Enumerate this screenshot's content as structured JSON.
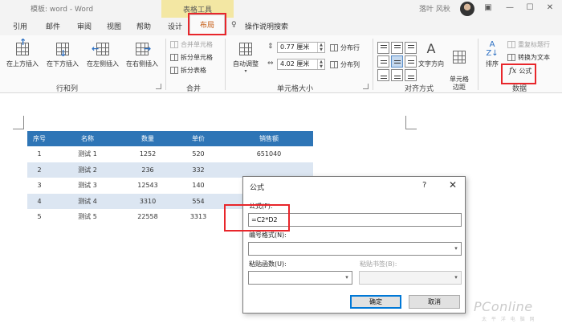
{
  "titlebar": {
    "doc_title": "模板: word - Word",
    "context_label": "表格工具",
    "user_name": "落叶 风秋",
    "min": "—",
    "restore": "☐",
    "close": "✕"
  },
  "tabs": [
    "引用",
    "邮件",
    "审阅",
    "视图",
    "帮助",
    "设计",
    "布局"
  ],
  "active_tab": "布局",
  "tell_me": "操作说明搜索",
  "ribbon": {
    "rows_cols": {
      "insert_above": "在上方插入",
      "insert_below": "在下方插入",
      "insert_left": "在左侧插入",
      "insert_right": "在右侧插入",
      "label": "行和列"
    },
    "merge": {
      "merge_cells": "合并单元格",
      "split_cells": "拆分单元格",
      "split_table": "拆分表格",
      "label": "合并"
    },
    "cell_size": {
      "autofit": "自动调整",
      "height": "0.77 厘米",
      "width": "4.02 厘米",
      "distribute_rows": "分布行",
      "distribute_cols": "分布列",
      "label": "单元格大小"
    },
    "alignment": {
      "text_direction": "文字方向",
      "cell_margins": "单元格\n边距",
      "label": "对齐方式"
    },
    "data": {
      "sort": "排序",
      "repeat_header": "重复标题行",
      "convert_to_text": "转换为文本",
      "formula": "公式",
      "label": "数据"
    }
  },
  "table": {
    "headers": [
      "序号",
      "名称",
      "数量",
      "单价",
      "销售额"
    ],
    "rows": [
      [
        "1",
        "测试 1",
        "1252",
        "520",
        "651040"
      ],
      [
        "2",
        "测试 2",
        "236",
        "332",
        ""
      ],
      [
        "3",
        "测试 3",
        "12543",
        "140",
        ""
      ],
      [
        "4",
        "测试 4",
        "3310",
        "554",
        ""
      ],
      [
        "5",
        "测试 5",
        "22558",
        "3313",
        ""
      ]
    ]
  },
  "dialog": {
    "title": "公式",
    "help": "?",
    "close": "✕",
    "formula_label": "公式(F):",
    "formula_value": "=C2*D2",
    "number_format_label": "编号格式(N):",
    "paste_function_label": "粘贴函数(U):",
    "paste_bookmark_label": "粘贴书签(B):",
    "ok": "确定",
    "cancel": "取消"
  },
  "watermark": {
    "brand": "PConline",
    "sub": "太 平 洋 电 脑 网"
  },
  "colors": {
    "accent": "#c55a11",
    "table_header": "#2e75b6",
    "table_alt_row": "#dce6f2",
    "highlight": "#e8262b",
    "context_tab_bg": "#f3e7a3"
  }
}
